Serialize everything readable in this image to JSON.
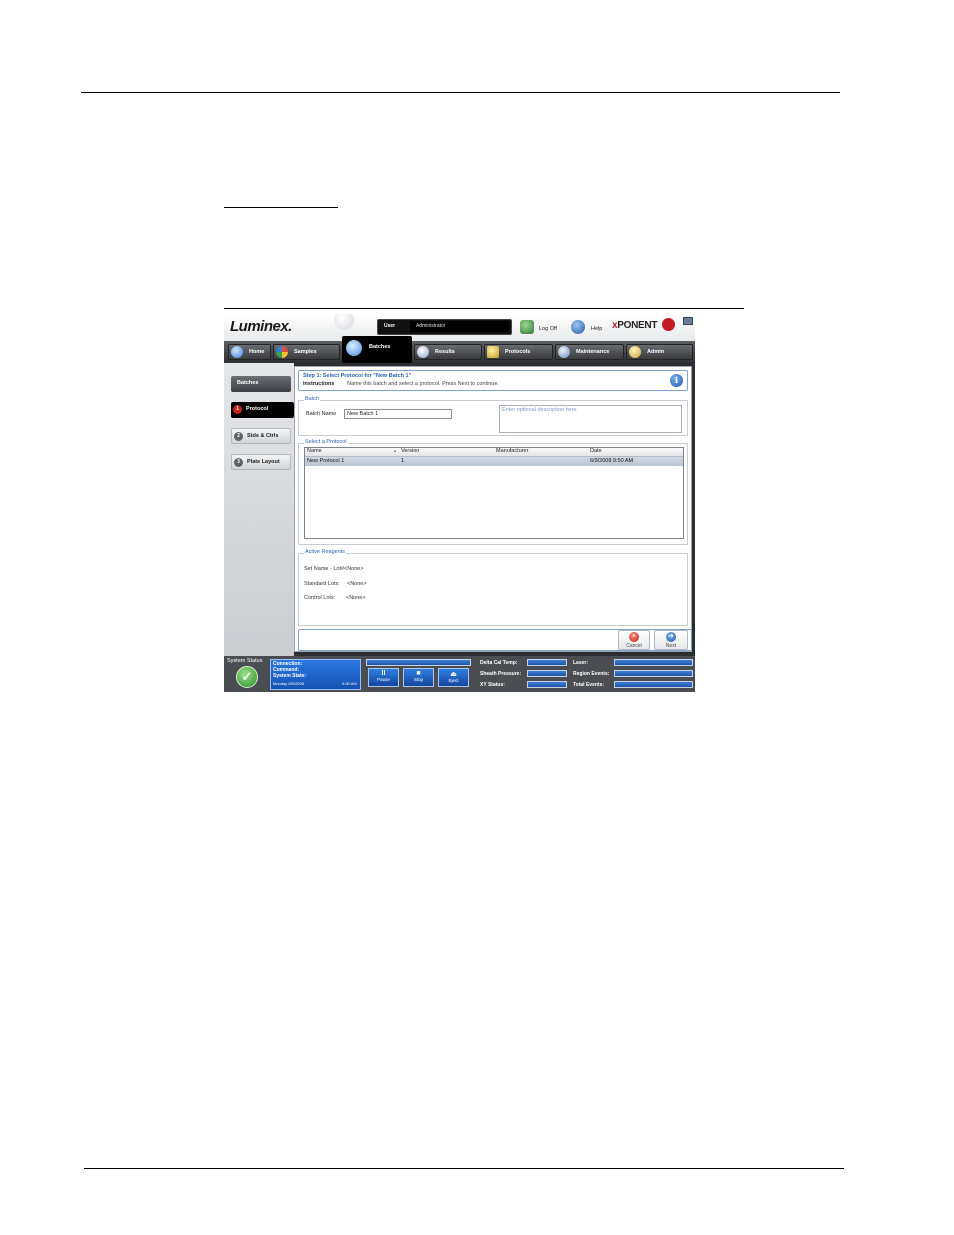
{
  "app": {
    "brand": "Luminex.",
    "product": {
      "x": "x",
      "rest": "PONENT"
    },
    "user_label": "User",
    "user_value": "Administrator",
    "logoff": "Log Off",
    "help": "Help",
    "accent": "#2a63b8",
    "active_tab_color": "#000000"
  },
  "nav": {
    "tabs": [
      {
        "label": "Home",
        "icon": "home-icon"
      },
      {
        "label": "Samples",
        "icon": "samples-icon"
      },
      {
        "label": "Batches",
        "icon": "batches-icon",
        "active": true
      },
      {
        "label": "Results",
        "icon": "results-icon"
      },
      {
        "label": "Protocols",
        "icon": "protocols-icon"
      },
      {
        "label": "Maintenance",
        "icon": "maintenance-icon"
      },
      {
        "label": "Admin",
        "icon": "admin-icon"
      }
    ]
  },
  "sidebar": {
    "header": "Batches",
    "steps": [
      {
        "num": "1",
        "label": "Protocol",
        "active": true
      },
      {
        "num": "2",
        "label": "Stds & Ctrls"
      },
      {
        "num": "3",
        "label": "Plate Layout"
      }
    ]
  },
  "step": {
    "title": "Step 1: Select Protocol for \"New Batch 1\"",
    "instructions_label": "Instructions",
    "instructions_text": "Name this batch and select a protocol. Press Next to continue."
  },
  "batch": {
    "group_label": "Batch",
    "name_label": "Batch Name",
    "name_value": "New Batch 1",
    "description_placeholder": "Enter optional description here"
  },
  "protocols": {
    "group_label": "Select a Protocol",
    "columns": [
      "Name",
      "Version",
      "Manufacturer",
      "Date"
    ],
    "rows": [
      [
        "New Protocol 1",
        "1",
        "",
        "6/9/2008 9:50 AM"
      ]
    ]
  },
  "reagents": {
    "group_label": "Active Reagents",
    "set_label": "Set Name - Lot#",
    "set_value": "<None>",
    "std_label": "Standard Lots:",
    "std_value": "<None>",
    "ctrl_label": "Control Lots:",
    "ctrl_value": "<None>"
  },
  "footer": {
    "cancel": "Cancel",
    "next": "Next"
  },
  "status": {
    "label": "System Status",
    "connection": "Connection:",
    "command": "Command:",
    "system_state": "System State:",
    "date": "Monday 6/9/2008",
    "time": "9:50 AM",
    "controls": [
      {
        "glyph": "II",
        "label": "Pause"
      },
      {
        "glyph": "■",
        "label": "Stop"
      },
      {
        "glyph": "⏏",
        "label": "Eject"
      }
    ],
    "readouts": {
      "delta": "Delta Cal Temp:",
      "sheath": "Sheath Pressure:",
      "xy": "XY Status:",
      "laser": "Laser:",
      "region": "Region Events:",
      "total": "Total Events:"
    }
  }
}
